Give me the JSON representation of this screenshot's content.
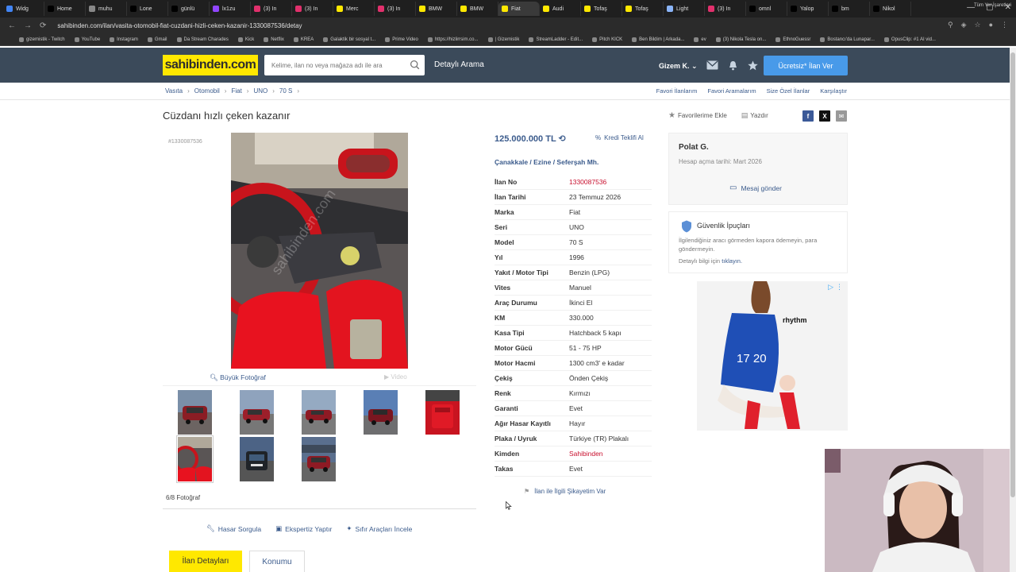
{
  "browser": {
    "tabs": [
      {
        "label": "Widg",
        "color": "#4285f4"
      },
      {
        "label": "Home",
        "color": "#000000"
      },
      {
        "label": "muhu",
        "color": "#888888"
      },
      {
        "label": "Lone",
        "color": "#000000"
      },
      {
        "label": "günlü",
        "color": "#000000"
      },
      {
        "label": "lx1zu",
        "color": "#9146ff"
      },
      {
        "label": "(3) In",
        "color": "#e1306c"
      },
      {
        "label": "(3) In",
        "color": "#e1306c"
      },
      {
        "label": "Merc",
        "color": "#ffe800"
      },
      {
        "label": "(3) In",
        "color": "#e1306c"
      },
      {
        "label": "BMW",
        "color": "#ffe800"
      },
      {
        "label": "BMW",
        "color": "#ffe800"
      },
      {
        "label": "Fiat",
        "color": "#ffe800"
      },
      {
        "label": "Audi",
        "color": "#ffe800"
      },
      {
        "label": "Tofaş",
        "color": "#ffe800"
      },
      {
        "label": "Tofaş",
        "color": "#ffe800"
      },
      {
        "label": "Light",
        "color": "#8ab4f8"
      },
      {
        "label": "(3) In",
        "color": "#e1306c"
      },
      {
        "label": "omnl",
        "color": "#000000"
      },
      {
        "label": "Yalop",
        "color": "#000000"
      },
      {
        "label": "bm",
        "color": "#000000"
      },
      {
        "label": "Nikol",
        "color": "#000000"
      }
    ],
    "url": "sahibinden.com/ilan/vasita-otomobil-fiat-cuzdani-hizli-ceken-kazanir-1330087536/detay",
    "bookmarks": [
      "gizemistik - Twitch",
      "YouTube",
      "Instagram",
      "Gmail",
      "Da Stream Charades",
      "Kick",
      "Netflix",
      "KREA",
      "Galaktik bir sosyal t...",
      "Prime Video",
      "https://hizlirrsim.co...",
      "| Gizemistik",
      "StreamLadder - Edit...",
      "Pitch KICK",
      "Ben Bildim | Arkada...",
      "ev",
      "(3) Nikola Tesla on...",
      "EthnoGuessr",
      "Bostancı'da Lunapar...",
      "OpusClip: #1 AI vid..."
    ],
    "bookmarks_right": "Tüm Yer İşaretleri"
  },
  "header": {
    "logo": "sahibinden.com",
    "search_placeholder": "Kelime, ilan no veya mağaza adı ile ara",
    "detailed_search": "Detaylı Arama",
    "user": "Gizem K.",
    "post_ad": "Ücretsiz* İlan Ver"
  },
  "breadcrumb": [
    "Vasıta",
    "Otomobil",
    "Fiat",
    "UNO",
    "70 S"
  ],
  "top_links": [
    "Favori İlanlarım",
    "Favori Aramalarım",
    "Size Özel İlanlar",
    "Karşılaştır"
  ],
  "ad": {
    "title": "Cüzdanı hızlı çeken kazanır",
    "id_small": "#1330087536",
    "add_favorite": "Favorilerime Ekle",
    "print": "Yazdır",
    "big_photo": "Büyük Fotoğraf",
    "video": "Video",
    "photo_count": "6/8 Fotoğraf",
    "price": "125.000.000 TL",
    "credit": "Kredi Teklifi Al",
    "location": "Çanakkale / Ezine / Seferşah Mh.",
    "complaint": "İlan ile İlgili Şikayetim Var"
  },
  "specs": [
    {
      "k": "İlan No",
      "v": "1330087536",
      "red": true
    },
    {
      "k": "İlan Tarihi",
      "v": "23 Temmuz 2026",
      "red": false
    },
    {
      "k": "Marka",
      "v": "Fiat",
      "red": false
    },
    {
      "k": "Seri",
      "v": "UNO",
      "red": false
    },
    {
      "k": "Model",
      "v": "70 S",
      "red": false
    },
    {
      "k": "Yıl",
      "v": "1996",
      "red": false
    },
    {
      "k": "Yakıt / Motor Tipi",
      "v": "Benzin (LPG)",
      "red": false
    },
    {
      "k": "Vites",
      "v": "Manuel",
      "red": false
    },
    {
      "k": "Araç Durumu",
      "v": "İkinci El",
      "red": false
    },
    {
      "k": "KM",
      "v": "330.000",
      "red": false
    },
    {
      "k": "Kasa Tipi",
      "v": "Hatchback 5 kapı",
      "red": false
    },
    {
      "k": "Motor Gücü",
      "v": "51 - 75 HP",
      "red": false
    },
    {
      "k": "Motor Hacmi",
      "v": "1300 cm3' e kadar",
      "red": false
    },
    {
      "k": "Çekiş",
      "v": "Önden Çekiş",
      "red": false
    },
    {
      "k": "Renk",
      "v": "Kırmızı",
      "red": false
    },
    {
      "k": "Garanti",
      "v": "Evet",
      "red": false
    },
    {
      "k": "Ağır Hasar Kayıtlı",
      "v": "Hayır",
      "red": false
    },
    {
      "k": "Plaka / Uyruk",
      "v": "Türkiye (TR) Plakalı",
      "red": false
    },
    {
      "k": "Kimden",
      "v": "Sahibinden",
      "red": true
    },
    {
      "k": "Takas",
      "v": "Evet",
      "red": false
    }
  ],
  "seller": {
    "name": "Polat G.",
    "since": "Hesap açma tarihi: Mart 2026",
    "send_message": "Mesaj gönder"
  },
  "safety": {
    "title": "Güvenlik İpuçları",
    "text": "İlgilendiğiniz aracı görmeden kapora ödemeyin, para göndermeyin.",
    "more_prefix": "Detaylı bilgi için",
    "more_link": "tıklayın."
  },
  "banner": {
    "brand": "rhythm"
  },
  "bottom_actions": [
    "Hasar Sorgula",
    "Ekspertiz Yaptır",
    "Sıfır Araçları İncele"
  ],
  "tabs": {
    "details": "İlan Detayları",
    "location": "Konumu"
  },
  "colors": {
    "header": "#3b4a5a",
    "brand_yellow": "#ffe800",
    "link": "#3b5b8c",
    "accent_red": "#c8102e",
    "button_blue": "#489ae9"
  }
}
